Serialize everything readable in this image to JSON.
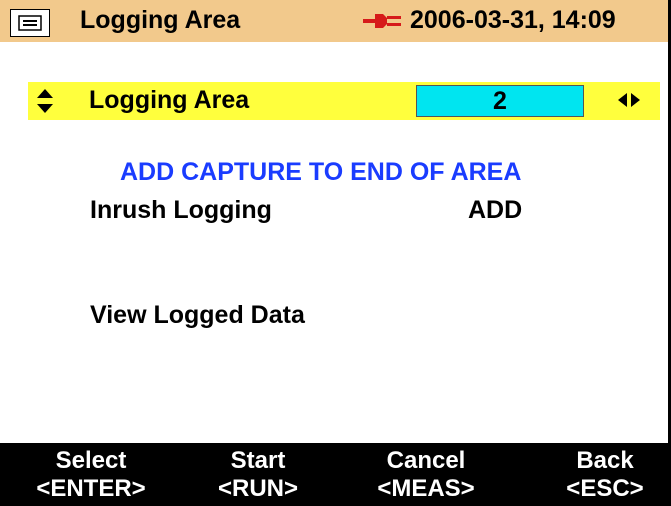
{
  "header": {
    "title": "Logging Area",
    "datetime": "2006-03-31, 14:09",
    "menu_icon": "menu-icon",
    "power_icon": "power-plug-icon"
  },
  "selection": {
    "label": "Logging Area",
    "value": "2",
    "left_icon": "up-down-arrows-icon",
    "right_icon": "left-right-arrows-icon"
  },
  "notice": "ADD CAPTURE TO END OF AREA",
  "menu": {
    "inrush_label": "Inrush Logging",
    "inrush_value": "ADD",
    "view_label": "View Logged Data"
  },
  "softkeys": [
    {
      "label": "Select",
      "key": "<ENTER>"
    },
    {
      "label": "Start",
      "key": "<RUN>"
    },
    {
      "label": "Cancel",
      "key": "<MEAS>"
    },
    {
      "label": "Back",
      "key": "<ESC>"
    }
  ],
  "colors": {
    "titlebar": "#f2c98c",
    "highlight_row": "#ffff3d",
    "value_box": "#00e5f0",
    "notice_text": "#1a3cff"
  }
}
